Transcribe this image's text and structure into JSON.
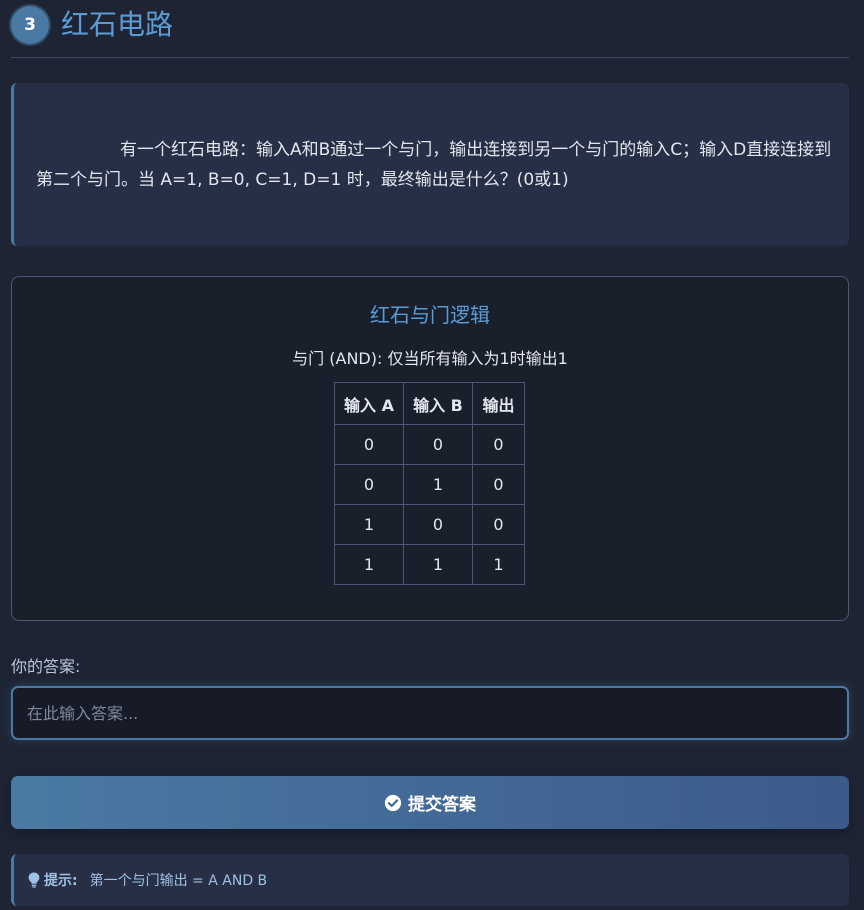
{
  "header": {
    "step_number": "3",
    "title": "红石电路"
  },
  "question": {
    "text": "有一个红石电路：输入A和B通过一个与门，输出连接到另一个与门的输入C；输入D直接连接到第二个与门。当 A=1, B=0, C=1, D=1 时，最终输出是什么？(0或1)"
  },
  "logic_panel": {
    "title": "红石与门逻辑",
    "subtitle": "与门 (AND): 仅当所有输入为1时输出1",
    "table": {
      "headers": [
        "输入 A",
        "输入 B",
        "输出"
      ],
      "rows": [
        [
          "0",
          "0",
          "0"
        ],
        [
          "0",
          "1",
          "0"
        ],
        [
          "1",
          "0",
          "0"
        ],
        [
          "1",
          "1",
          "1"
        ]
      ]
    }
  },
  "answer": {
    "label": "你的答案:",
    "placeholder": "在此输入答案...",
    "value": ""
  },
  "submit": {
    "label": "提交答案",
    "icon": "check-circle-icon"
  },
  "hint": {
    "icon": "lightbulb-icon",
    "label": "提示:",
    "text": "第一个与门输出 = A AND B"
  },
  "colors": {
    "background": "#1e2433",
    "accent": "#4a7aa3",
    "title_blue": "#5b9bd5",
    "card": "#262f45"
  }
}
